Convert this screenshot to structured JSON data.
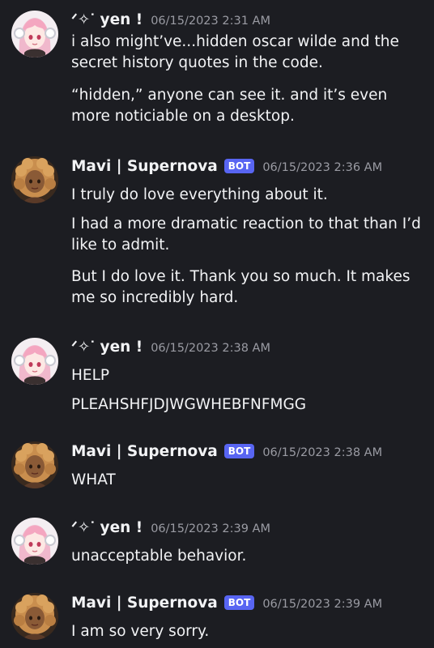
{
  "messages": [
    {
      "username": "ᐟ✧ᐝ yen !",
      "timestamp": "06/15/2023 2:31 AM",
      "is_bot": false,
      "avatar": "anime-girl-avatar",
      "lines": [
        "i also might’ve...hidden oscar wilde and the secret history quotes in the code.",
        "“hidden,” anyone can see it. and it’s even more noticiable on a desktop."
      ]
    },
    {
      "username": "Mavi | Supernova",
      "bot_tag": "BOT",
      "timestamp": "06/15/2023 2:36 AM",
      "is_bot": true,
      "avatar": "curly-hair-avatar",
      "lines": [
        "I truly do love everything about it.",
        "I had a more dramatic reaction to that than I’d like to admit.",
        "But I do love it. Thank you so much. It makes me so incredibly hard."
      ]
    },
    {
      "username": "ᐟ✧ᐝ yen !",
      "timestamp": "06/15/2023 2:38 AM",
      "is_bot": false,
      "avatar": "anime-girl-avatar",
      "lines": [
        "HELP",
        "PLEAHSHFJDJWGWHEBFNFMGG"
      ]
    },
    {
      "username": "Mavi | Supernova",
      "bot_tag": "BOT",
      "timestamp": "06/15/2023 2:38 AM",
      "is_bot": true,
      "avatar": "curly-hair-avatar",
      "lines": [
        "WHAT"
      ]
    },
    {
      "username": "ᐟ✧ᐝ yen !",
      "timestamp": "06/15/2023 2:39 AM",
      "is_bot": false,
      "avatar": "anime-girl-avatar",
      "lines": [
        "unacceptable behavior."
      ]
    },
    {
      "username": "Mavi | Supernova",
      "bot_tag": "BOT",
      "timestamp": "06/15/2023 2:39 AM",
      "is_bot": true,
      "avatar": "curly-hair-avatar",
      "lines": [
        "I am so very sorry."
      ]
    }
  ],
  "colors": {
    "background": "#1c1d22",
    "text": "#f2f3f5",
    "timestamp": "#9a9ba3",
    "bot_tag": "#5865f2"
  }
}
